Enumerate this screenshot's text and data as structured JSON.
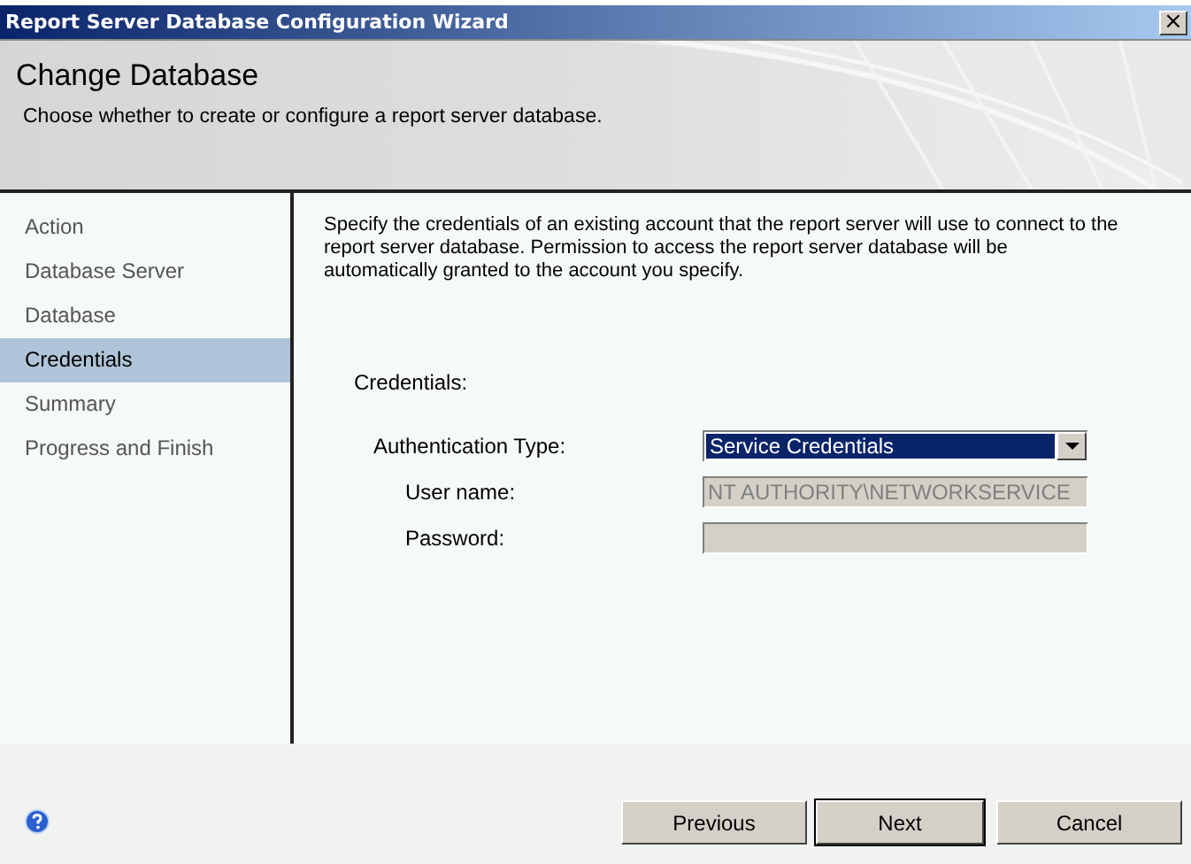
{
  "window": {
    "title": "Report Server Database Configuration Wizard",
    "close": "×"
  },
  "header": {
    "title": "Change Database",
    "subtitle": "Choose whether to create or configure a report server database."
  },
  "sidebar": {
    "items": [
      {
        "label": "Action",
        "selected": false
      },
      {
        "label": "Database Server",
        "selected": false
      },
      {
        "label": "Database",
        "selected": false
      },
      {
        "label": "Credentials",
        "selected": true
      },
      {
        "label": "Summary",
        "selected": false
      },
      {
        "label": "Progress and Finish",
        "selected": false
      }
    ]
  },
  "content": {
    "description": "Specify the credentials of an existing account that the report server will use to connect to the report server database.  Permission to access the report server database will be automatically granted to the account you specify.",
    "section_label": "Credentials:",
    "fields": [
      {
        "kind": "dropdown",
        "label": "Authentication Type:",
        "value": "Service Credentials",
        "disabled": false
      },
      {
        "kind": "text",
        "label": "User name:",
        "value": "NT AUTHORITY\\NETWORKSERVICE",
        "disabled": true
      },
      {
        "kind": "text",
        "label": "Password:",
        "disabled": true
      }
    ]
  },
  "buttons": [
    {
      "label": "Previous",
      "default": false
    },
    {
      "label": "Next",
      "default": true
    },
    {
      "label": "Cancel",
      "default": false
    }
  ]
}
